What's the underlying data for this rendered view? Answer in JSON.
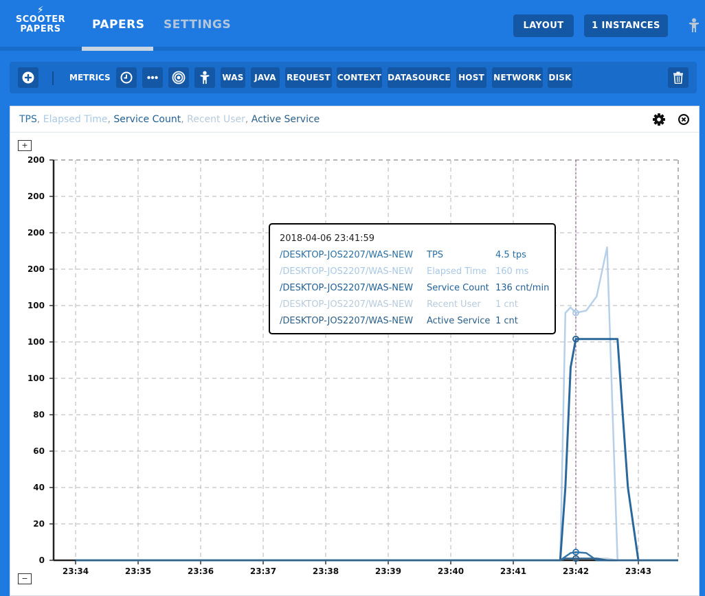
{
  "app": {
    "logo_line1": "SCOOTER",
    "logo_line2": "PAPERS"
  },
  "nav": {
    "papers": "PAPERS",
    "settings": "SETTINGS"
  },
  "top_buttons": {
    "layout": "LAYOUT",
    "instances": "1 INSTANCES"
  },
  "toolbar": {
    "add_icon": "plus-circle-icon",
    "metrics": "METRICS",
    "clock_icon": "clock-icon",
    "more_icon": "ellipsis-icon",
    "target_icon": "target-icon",
    "person_icon": "person-icon",
    "categories": [
      "WAS",
      "JAVA",
      "REQUEST",
      "CONTEXT",
      "DATASOURCE",
      "HOST",
      "NETWORK",
      "DISK"
    ],
    "trash_icon": "trash-icon"
  },
  "panel": {
    "legend": [
      {
        "label": "TPS",
        "color": "#2a6fa5"
      },
      {
        "label": "Elapsed Time",
        "color": "#a9c8e6"
      },
      {
        "label": "Service Count",
        "color": "#1f5f96"
      },
      {
        "label": "Recent User",
        "color": "#b8cbdd"
      },
      {
        "label": "Active Service",
        "color": "#2a5f8a"
      }
    ],
    "legend_separator": ",",
    "zoom_in": "+",
    "zoom_out": "−"
  },
  "tooltip": {
    "time": "2018-04-06 23:41:59",
    "rows": [
      {
        "source": "/DESKTOP-JOS2207/WAS-NEW",
        "metric": "TPS",
        "value": "4.5 tps",
        "color": "#2a6fa5"
      },
      {
        "source": "/DESKTOP-JOS2207/WAS-NEW",
        "metric": "Elapsed Time",
        "value": "160 ms",
        "color": "#a9c8e6"
      },
      {
        "source": "/DESKTOP-JOS2207/WAS-NEW",
        "metric": "Service Count",
        "value": "136 cnt/min",
        "color": "#1f5f96"
      },
      {
        "source": "/DESKTOP-JOS2207/WAS-NEW",
        "metric": "Recent User",
        "value": "1 cnt",
        "color": "#b8cbdd"
      },
      {
        "source": "/DESKTOP-JOS2207/WAS-NEW",
        "metric": "Active Service",
        "value": "1 cnt",
        "color": "#2a5f8a"
      }
    ]
  },
  "chart_data": {
    "type": "line",
    "y_tick_labels": [
      "0",
      "20",
      "40",
      "60",
      "80",
      "100",
      "100",
      "100",
      "200",
      "200",
      "200",
      "200"
    ],
    "x_tick_labels": [
      "23:34",
      "23:35",
      "23:36",
      "23:37",
      "23:38",
      "23:39",
      "23:40",
      "23:41",
      "23:42",
      "23:43"
    ],
    "x": [
      "23:34",
      "23:35",
      "23:36",
      "23:37",
      "23:38",
      "23:39",
      "23:40",
      "23:41",
      "23:41:45",
      "23:41:50",
      "23:41:55",
      "23:42",
      "23:42:10",
      "23:42:20",
      "23:42:30",
      "23:42:40",
      "23:42:45",
      "23:42:50",
      "23:43",
      "23:43:40"
    ],
    "grid": true,
    "cursor_time": "23:42",
    "series": [
      {
        "name": "TPS",
        "values": [
          0,
          0,
          0,
          0,
          0,
          0,
          0,
          0,
          0,
          2,
          4,
          4.5,
          4,
          0,
          0,
          0,
          0,
          0,
          0,
          0
        ]
      },
      {
        "name": "Elapsed Time",
        "values": [
          0,
          0,
          0,
          0,
          0,
          0,
          0,
          0,
          0,
          160,
          165,
          160,
          162,
          175,
          220,
          0,
          0,
          0,
          0,
          0
        ]
      },
      {
        "name": "Service Count",
        "values": [
          0,
          0,
          0,
          0,
          0,
          0,
          0,
          0,
          0,
          40,
          110,
          136,
          136,
          136,
          136,
          136,
          80,
          40,
          0,
          0
        ]
      },
      {
        "name": "Recent User",
        "values": [
          0,
          0,
          0,
          0,
          0,
          0,
          0,
          0,
          0,
          1,
          1,
          1,
          1,
          1,
          1,
          0,
          0,
          0,
          0,
          0
        ]
      },
      {
        "name": "Active Service",
        "values": [
          0,
          0,
          0,
          0,
          0,
          0,
          0,
          0,
          0,
          1,
          1,
          1,
          1,
          1,
          0,
          0,
          0,
          0,
          0,
          0
        ]
      }
    ]
  }
}
